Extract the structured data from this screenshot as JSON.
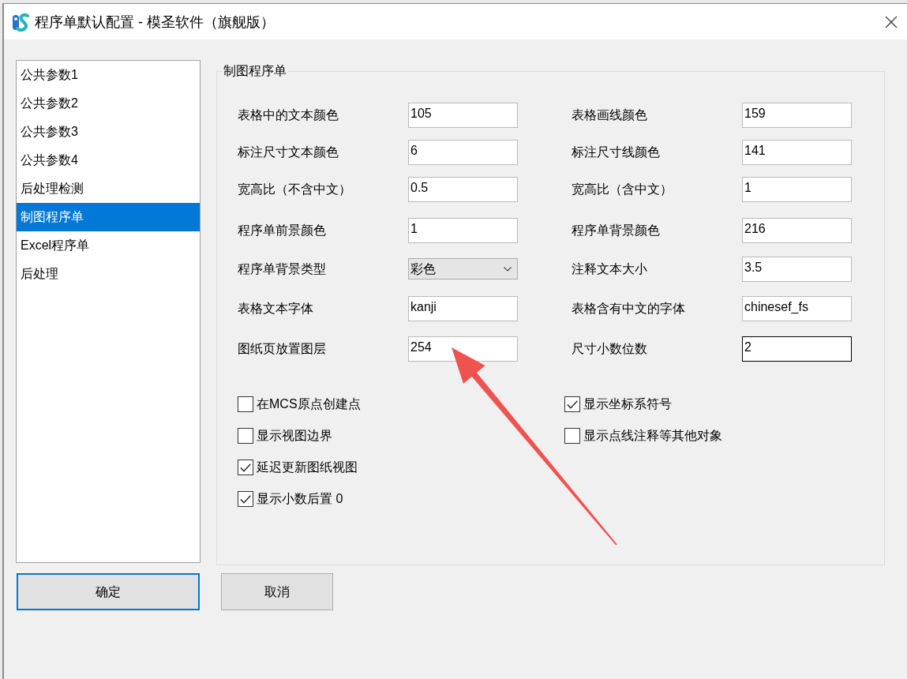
{
  "window": {
    "title": "程序单默认配置 - 模圣软件（旗舰版）"
  },
  "sidebar": {
    "items": [
      {
        "label": "公共参数1",
        "selected": false
      },
      {
        "label": "公共参数2",
        "selected": false
      },
      {
        "label": "公共参数3",
        "selected": false
      },
      {
        "label": "公共参数4",
        "selected": false
      },
      {
        "label": "后处理检测",
        "selected": false
      },
      {
        "label": "制图程序单",
        "selected": true
      },
      {
        "label": "Excel程序单",
        "selected": false
      },
      {
        "label": "后处理",
        "selected": false
      }
    ]
  },
  "group": {
    "title": "制图程序单",
    "fields": [
      {
        "label": "表格中的文本颜色",
        "kind": "text",
        "value": "105",
        "focused": false
      },
      {
        "label": "表格画线颜色",
        "kind": "text",
        "value": "159",
        "focused": false
      },
      {
        "label": "标注尺寸文本颜色",
        "kind": "text",
        "value": "6",
        "focused": false
      },
      {
        "label": "标注尺寸线颜色",
        "kind": "text",
        "value": "141",
        "focused": false
      },
      {
        "label": "宽高比（不含中文）",
        "kind": "text",
        "value": "0.5",
        "focused": false
      },
      {
        "label": "宽高比（含中文）",
        "kind": "text",
        "value": "1",
        "focused": false
      },
      {
        "label": "程序单前景颜色",
        "kind": "text",
        "value": "1",
        "focused": false
      },
      {
        "label": "程序单背景颜色",
        "kind": "text",
        "value": "216",
        "focused": false
      },
      {
        "label": "程序单背景类型",
        "kind": "dropdown",
        "value": "彩色",
        "focused": false
      },
      {
        "label": "注释文本大小",
        "kind": "text",
        "value": "3.5",
        "focused": false
      },
      {
        "label": "表格文本字体",
        "kind": "text",
        "value": "kanji",
        "focused": false
      },
      {
        "label": "表格含有中文的字体",
        "kind": "text",
        "value": "chinesef_fs",
        "focused": false
      },
      {
        "label": "图纸页放置图层",
        "kind": "text",
        "value": "254",
        "focused": false
      },
      {
        "label": "尺寸小数位数",
        "kind": "text",
        "value": "2",
        "focused": true
      }
    ],
    "checkbox_columns": [
      {
        "items": [
          {
            "label": "在MCS原点创建点",
            "checked": false
          },
          {
            "label": "显示视图边界",
            "checked": false
          },
          {
            "label": "延迟更新图纸视图",
            "checked": true
          },
          {
            "label": "显示小数后置 0",
            "checked": true
          }
        ]
      },
      {
        "items": [
          {
            "label": "显示坐标系符号",
            "checked": true
          },
          {
            "label": "显示点线注释等其他对象",
            "checked": false
          }
        ]
      }
    ]
  },
  "buttons": [
    {
      "label": "确定",
      "default": true
    },
    {
      "label": "取消",
      "default": false
    }
  ]
}
